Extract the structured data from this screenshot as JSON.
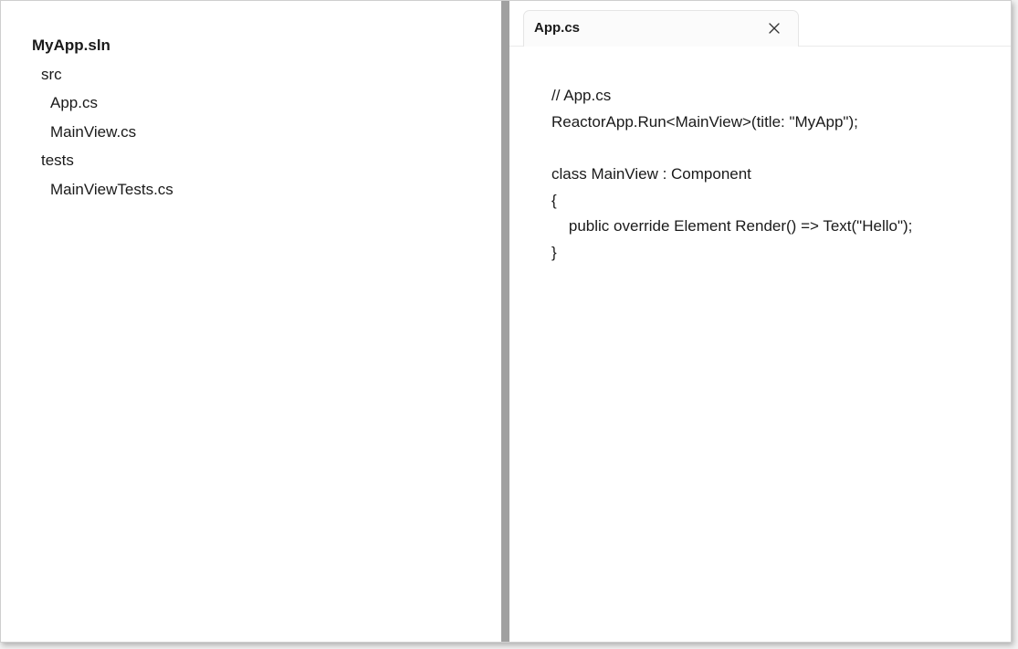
{
  "explorer": {
    "items": [
      {
        "label": "MyApp.sln",
        "level": 0
      },
      {
        "label": "src",
        "level": 1
      },
      {
        "label": "App.cs",
        "level": 2
      },
      {
        "label": "MainView.cs",
        "level": 2
      },
      {
        "label": "tests",
        "level": 1
      },
      {
        "label": "MainViewTests.cs",
        "level": 2
      }
    ]
  },
  "editor": {
    "tab": {
      "label": "App.cs",
      "close_icon": "close-icon"
    },
    "code_lines": [
      "// App.cs",
      "ReactorApp.Run<MainView>(title: \"MyApp\");",
      "",
      "class MainView : Component",
      "{",
      "    public override Element Render() => Text(\"Hello\");",
      "}"
    ]
  },
  "colors": {
    "splitter": "#a0a0a0",
    "window_background": "#ffffff",
    "text": "#1a1a1a"
  }
}
